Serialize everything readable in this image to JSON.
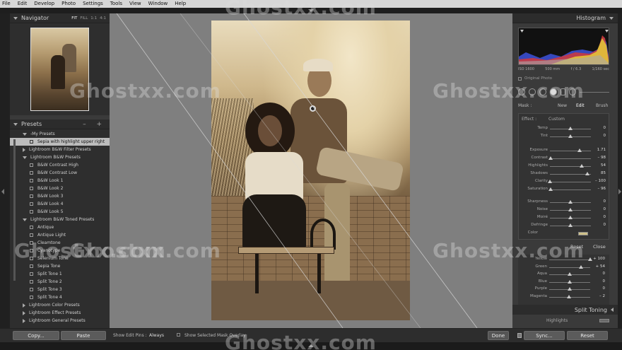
{
  "menu": [
    "File",
    "Edit",
    "Develop",
    "Photo",
    "Settings",
    "Tools",
    "View",
    "Window",
    "Help"
  ],
  "watermark": "Ghostxx.com",
  "navigator": {
    "title": "Navigator",
    "modes": [
      "FIT",
      "FILL",
      "1:1",
      "4:1"
    ]
  },
  "presets": {
    "title": "Presets",
    "icons": "– +",
    "rows": [
      {
        "type": "folder",
        "open": true,
        "label": "-My Presets"
      },
      {
        "type": "item",
        "selected": true,
        "label": "Sepia with highlight upper right"
      },
      {
        "type": "folder",
        "open": false,
        "label": "Lightroom B&W Filter Presets"
      },
      {
        "type": "folder",
        "open": true,
        "label": "Lightroom B&W Presets"
      },
      {
        "type": "item",
        "label": "B&W Contrast High"
      },
      {
        "type": "item",
        "label": "B&W Contrast Low"
      },
      {
        "type": "item",
        "label": "B&W Look 1"
      },
      {
        "type": "item",
        "label": "B&W Look 2"
      },
      {
        "type": "item",
        "label": "B&W Look 3"
      },
      {
        "type": "item",
        "label": "B&W Look 4"
      },
      {
        "type": "item",
        "label": "B&W Look 5"
      },
      {
        "type": "folder",
        "open": true,
        "label": "Lightroom B&W Toned Presets"
      },
      {
        "type": "item",
        "label": "Antique"
      },
      {
        "type": "item",
        "label": "Antique Light"
      },
      {
        "type": "item",
        "label": "Cleamtone"
      },
      {
        "type": "item",
        "label": "Cyanotype"
      },
      {
        "type": "item",
        "label": "Selenium Tone"
      },
      {
        "type": "item",
        "label": "Sepia Tone"
      },
      {
        "type": "item",
        "label": "Split Tone 1"
      },
      {
        "type": "item",
        "label": "Split Tone 2"
      },
      {
        "type": "item",
        "label": "Split Tone 3"
      },
      {
        "type": "item",
        "label": "Split Tone 4"
      },
      {
        "type": "folder",
        "open": false,
        "label": "Lightroom Color Presets"
      },
      {
        "type": "folder",
        "open": false,
        "label": "Lightroom Effect Presets"
      },
      {
        "type": "folder",
        "open": false,
        "label": "Lightroom General Presets"
      }
    ]
  },
  "left_buttons": {
    "copy": "Copy...",
    "paste": "Paste"
  },
  "toolbar": {
    "pins_label": "Show Edit Pins :",
    "pins_value": "Always",
    "overlay_label": "Show Selected Mask Overlay",
    "done": "Done"
  },
  "right_buttons": {
    "sync": "Sync...",
    "reset": "Reset"
  },
  "histogram": {
    "title": "Histogram",
    "iso": "ISO 1600",
    "focal": "500 mm",
    "aperture": "f / 6.3",
    "shutter": "1/160 sec",
    "original": "Original Photo"
  },
  "mask": {
    "label": "Mask :",
    "new": "New",
    "edit": "Edit",
    "brush": "Brush"
  },
  "effect": {
    "label": "Effect :",
    "value": "Custom"
  },
  "adjust": [
    {
      "label": "Temp",
      "value": "0",
      "pos": 0.5
    },
    {
      "label": "Tint",
      "value": "0",
      "pos": 0.5
    },
    {
      "label": "Exposure",
      "value": "1.71",
      "pos": 0.72
    },
    {
      "label": "Contrast",
      "value": "– 98",
      "pos": 0.02
    },
    {
      "label": "Highlights",
      "value": "54",
      "pos": 0.77
    },
    {
      "label": "Shadows",
      "value": "85",
      "pos": 0.92
    },
    {
      "label": "Clarity",
      "value": "– 100",
      "pos": 0.0
    },
    {
      "label": "Saturation",
      "value": "– 96",
      "pos": 0.02
    },
    {
      "label": "Sharpness",
      "value": "0",
      "pos": 0.5
    },
    {
      "label": "Noise",
      "value": "0",
      "pos": 0.5
    },
    {
      "label": "Moiré",
      "value": "0",
      "pos": 0.5
    },
    {
      "label": "Defringe",
      "value": "0",
      "pos": 0.5
    }
  ],
  "color_label": "Color",
  "adj_buttons": {
    "reset": "Reset",
    "close": "Close"
  },
  "hsl": [
    {
      "label": "Yellow",
      "value": "+ 100",
      "pos": 1.0
    },
    {
      "label": "Green",
      "value": "+ 54",
      "pos": 0.77
    },
    {
      "label": "Aqua",
      "value": "0",
      "pos": 0.5
    },
    {
      "label": "Blue",
      "value": "0",
      "pos": 0.5
    },
    {
      "label": "Purple",
      "value": "0",
      "pos": 0.5
    },
    {
      "label": "Magenta",
      "value": "– 2",
      "pos": 0.49
    }
  ],
  "split_toning": {
    "title": "Split Toning",
    "highlights": "Highlights"
  }
}
